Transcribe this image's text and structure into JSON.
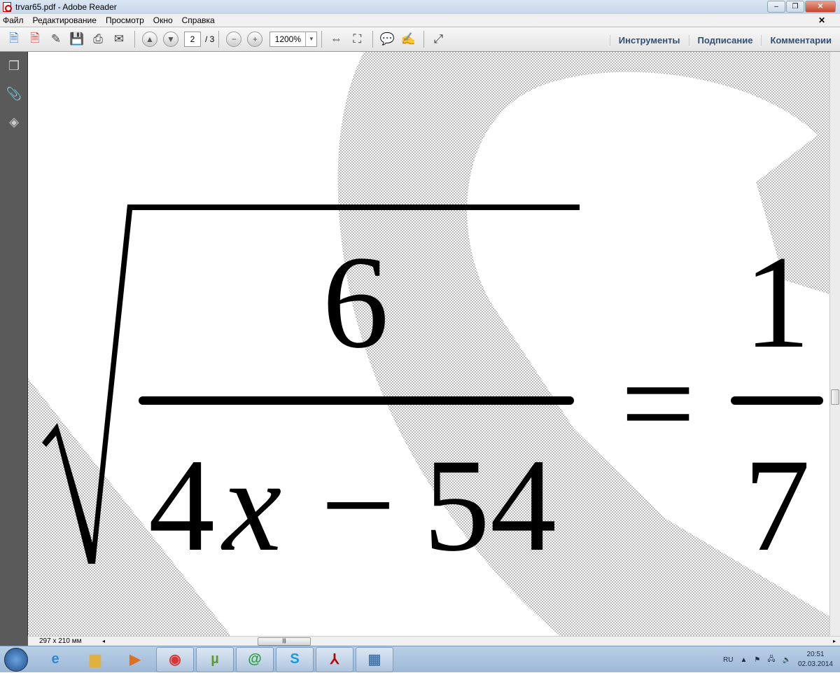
{
  "window": {
    "title": "trvar65.pdf - Adobe Reader"
  },
  "menu": [
    "Файл",
    "Редактирование",
    "Просмотр",
    "Окно",
    "Справка"
  ],
  "toolbar": {
    "page_current": "2",
    "page_total": "/ 3",
    "zoom": "1200%",
    "tabs": [
      "Инструменты",
      "Подписание",
      "Комментарии"
    ]
  },
  "document": {
    "numerator": "6",
    "denominator_coef": "4",
    "denominator_var": "x",
    "denominator_op": "−",
    "denominator_const": "54",
    "equals": "=",
    "rhs_num": "1",
    "rhs_den": "7"
  },
  "status": {
    "page_size": "297 x 210 мм"
  },
  "taskbar": {
    "lang": "RU",
    "time": "20:51",
    "date": "02.03.2014"
  }
}
